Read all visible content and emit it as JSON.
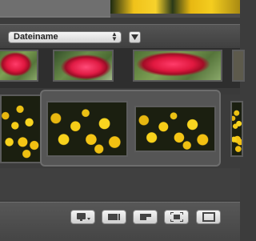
{
  "sort": {
    "selected": "Dateiname",
    "arrows_icon": "updown-arrows-icon",
    "toggle_icon": "triangle-down-icon"
  },
  "colors": {
    "background": "#3c3c3c",
    "panel": "#555555",
    "button": "#e6e6e6"
  },
  "toolbar": {
    "buttons": [
      {
        "name": "display-mode-button",
        "icon": "monitor-icon"
      },
      {
        "name": "view-button-1",
        "icon": "view-icon"
      },
      {
        "name": "view-button-2",
        "icon": "view-icon"
      },
      {
        "name": "fullscreen-button",
        "icon": "expand-icon"
      },
      {
        "name": "view-button-3",
        "icon": "window-icon"
      }
    ]
  }
}
